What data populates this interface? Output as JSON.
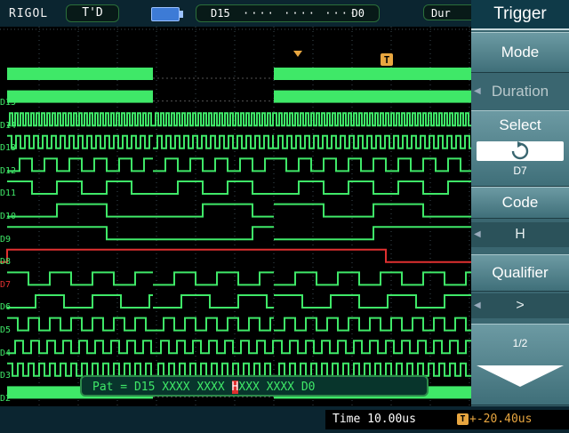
{
  "top": {
    "brand": "RIGOL",
    "status": "T'D",
    "channel_start": "D15",
    "channel_end": "D0",
    "dur_tab": "Dur"
  },
  "menu": {
    "title": "Trigger",
    "mode_label": "Mode",
    "duration_label": "Duration",
    "select_label": "Select",
    "select_value": "D7",
    "code_label": "Code",
    "code_value": "H",
    "qualifier_label": "Qualifier",
    "qualifier_value": ">",
    "page_label": "1/2"
  },
  "bottom": {
    "time": "Time 10.00us",
    "trigger_offset": "+-20.40us"
  },
  "pattern": {
    "prefix": "Pat = D15 XXXX XXXX ",
    "highlight": "H",
    "suffix": "XXX XXXX D0"
  },
  "channels": [
    {
      "name": "D15",
      "color": "#3fe868"
    },
    {
      "name": "D14",
      "color": "#3fe868"
    },
    {
      "name": "D13",
      "color": "#3fe868"
    },
    {
      "name": "D12",
      "color": "#3fe868"
    },
    {
      "name": "D11",
      "color": "#3fe868"
    },
    {
      "name": "D10",
      "color": "#3fe868"
    },
    {
      "name": "D9",
      "color": "#3fe868"
    },
    {
      "name": "D8",
      "color": "#3fe868"
    },
    {
      "name": "D7",
      "color": "#e03030"
    },
    {
      "name": "D6",
      "color": "#3fe868"
    },
    {
      "name": "D5",
      "color": "#3fe868"
    },
    {
      "name": "D4",
      "color": "#3fe868"
    },
    {
      "name": "D3",
      "color": "#3fe868"
    },
    {
      "name": "D2",
      "color": "#3fe868"
    },
    {
      "name": "D1",
      "color": "#3fe868"
    },
    {
      "name": "D0",
      "color": "#3fe868"
    }
  ],
  "colors": {
    "trace": "#3fe868",
    "selected_trace": "#e03030",
    "trigger": "#e8a640"
  },
  "icons": {
    "battery": "battery-icon",
    "rotate": "rotate-icon",
    "page_down": "arrow-down-icon",
    "trigger": "trigger-marker-icon"
  }
}
